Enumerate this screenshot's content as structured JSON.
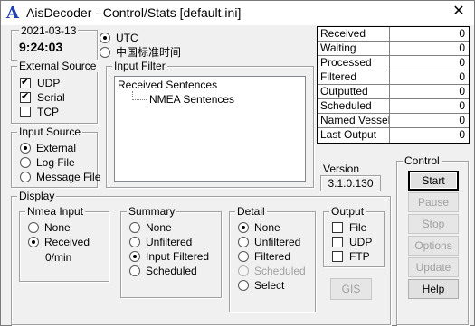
{
  "window": {
    "app_icon_letter": "A",
    "title": "AisDecoder - Control/Stats [default.ini]",
    "close_glyph": "✕"
  },
  "clock": {
    "date": "2021-03-13",
    "time": "9:24:03",
    "utc_label": "UTC",
    "local_label": "中国标准时间",
    "selected": "utc"
  },
  "external_source": {
    "title": "External Source",
    "items": [
      {
        "label": "UDP",
        "checked": true
      },
      {
        "label": "Serial",
        "checked": true
      },
      {
        "label": "TCP",
        "checked": false
      }
    ]
  },
  "input_source": {
    "title": "Input Source",
    "items": [
      {
        "label": "External",
        "selected": true
      },
      {
        "label": "Log File",
        "selected": false
      },
      {
        "label": "Message File",
        "selected": false
      }
    ]
  },
  "input_filter": {
    "title": "Input Filter",
    "root": "Received Sentences",
    "child": "NMEA Sentences"
  },
  "stats": [
    {
      "label": "Received",
      "value": "0"
    },
    {
      "label": "Waiting",
      "value": "0"
    },
    {
      "label": "Processed",
      "value": "0"
    },
    {
      "label": "Filtered",
      "value": "0"
    },
    {
      "label": "Outputted",
      "value": "0"
    },
    {
      "label": "Scheduled",
      "value": "0"
    },
    {
      "label": "Named Vessels",
      "value": "0"
    },
    {
      "label": "Last Output",
      "value": "0"
    }
  ],
  "version": {
    "title": "Version",
    "value": "3.1.0.130"
  },
  "control": {
    "title": "Control",
    "buttons": [
      {
        "label": "Start",
        "enabled": true
      },
      {
        "label": "Pause",
        "enabled": false
      },
      {
        "label": "Stop",
        "enabled": false
      },
      {
        "label": "Options",
        "enabled": false
      },
      {
        "label": "Update",
        "enabled": false
      },
      {
        "label": "Help",
        "enabled": true
      }
    ]
  },
  "display": {
    "title": "Display",
    "nmea_input": {
      "title": "Nmea Input",
      "items": [
        {
          "label": "None",
          "selected": false
        },
        {
          "label": "Received",
          "selected": true
        }
      ],
      "rate": "0/min"
    },
    "summary": {
      "title": "Summary",
      "items": [
        {
          "label": "None",
          "selected": false
        },
        {
          "label": "Unfiltered",
          "selected": false
        },
        {
          "label": "Input Filtered",
          "selected": true
        },
        {
          "label": "Scheduled",
          "selected": false
        }
      ]
    },
    "detail": {
      "title": "Detail",
      "items": [
        {
          "label": "None",
          "selected": true,
          "enabled": true
        },
        {
          "label": "Unfiltered",
          "selected": false,
          "enabled": true
        },
        {
          "label": "Filtered",
          "selected": false,
          "enabled": true
        },
        {
          "label": "Scheduled",
          "selected": false,
          "enabled": false
        },
        {
          "label": "Select",
          "selected": false,
          "enabled": true
        }
      ]
    },
    "output": {
      "title": "Output",
      "items": [
        {
          "label": "File",
          "checked": false
        },
        {
          "label": "UDP",
          "checked": false
        },
        {
          "label": "FTP",
          "checked": false
        }
      ]
    },
    "gis_button": "GIS"
  }
}
